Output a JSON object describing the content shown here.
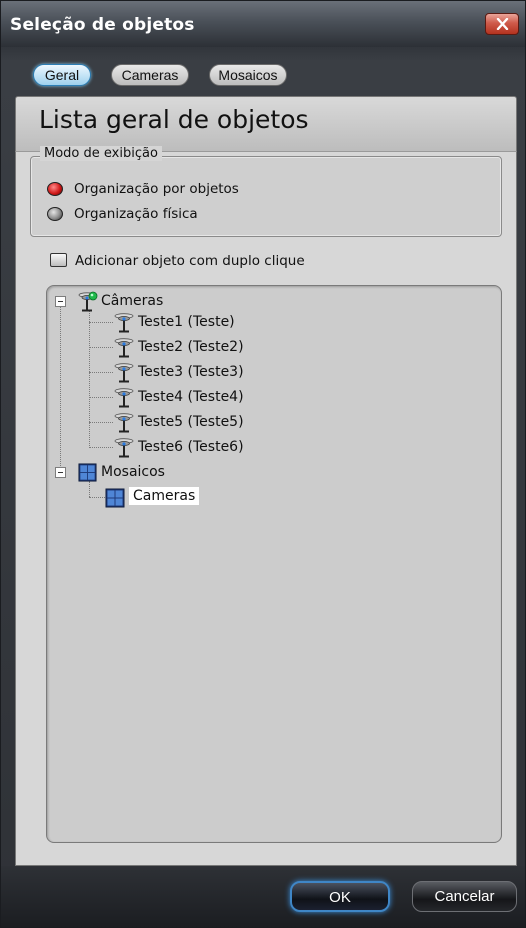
{
  "window": {
    "title": "Seleção de objetos"
  },
  "tabs": [
    {
      "label": "Geral",
      "active": true
    },
    {
      "label": "Cameras",
      "active": false
    },
    {
      "label": "Mosaicos",
      "active": false
    }
  ],
  "header": {
    "title": "Lista geral de objetos"
  },
  "display_mode": {
    "legend": "Modo de exibição",
    "options": [
      {
        "label": "Organização por objetos",
        "selected": true
      },
      {
        "label": "Organização física",
        "selected": false
      }
    ]
  },
  "add_on_double_click": {
    "label": "Adicionar objeto com duplo clique",
    "checked": false
  },
  "tree": {
    "cameras_group": {
      "label": "Câmeras",
      "icon": "camera-group-icon",
      "items": [
        {
          "label": "Teste1 (Teste)",
          "icon": "camera-icon"
        },
        {
          "label": "Teste2 (Teste2)",
          "icon": "camera-icon"
        },
        {
          "label": "Teste3 (Teste3)",
          "icon": "camera-icon"
        },
        {
          "label": "Teste4 (Teste4)",
          "icon": "camera-icon"
        },
        {
          "label": "Teste5 (Teste5)",
          "icon": "camera-icon"
        },
        {
          "label": "Teste6 (Teste6)",
          "icon": "camera-icon"
        }
      ]
    },
    "mosaics_group": {
      "label": "Mosaicos",
      "icon": "mosaic-grid-icon",
      "items": [
        {
          "label": "Cameras",
          "icon": "mosaic-grid-icon",
          "selected": true
        }
      ]
    }
  },
  "footer": {
    "ok_label": "OK",
    "cancel_label": "Cancelar"
  },
  "colors": {
    "accent": "#3f86c6",
    "radio_selected": "#d11a1a",
    "close": "#cf5b4b"
  }
}
